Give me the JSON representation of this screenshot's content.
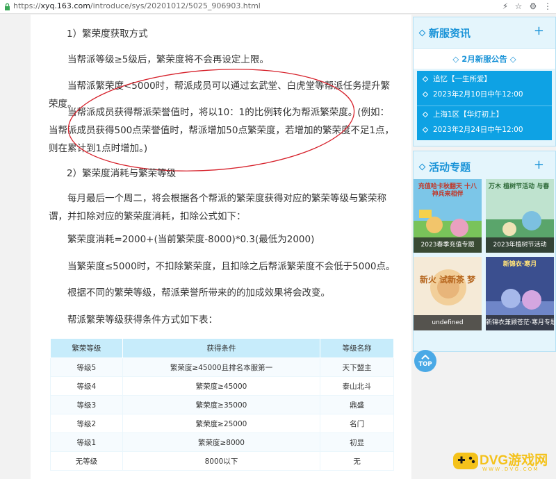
{
  "browser": {
    "url_scheme": "https://",
    "url_host": "xyq.163.com",
    "url_path": "/introduce/sys/20201012/5025_906903.html"
  },
  "article": {
    "heading1": "1）繁荣度获取方式",
    "p1": "当帮派等级≥5级后，繁荣度将不会再设定上限。",
    "p2": "当帮派繁荣度<5000时，帮派成员可以通过玄武堂、白虎堂等帮派任务提升繁荣度。",
    "p3": "当帮派成员获得帮派荣誉值时，将以10：1的比例转化为帮派繁荣度。(例如：当帮派成员获得500点荣誉值时，帮派增加50点繁荣度，若增加的繁荣度不足1点，则在累计到1点时增加。)",
    "heading2": "2）繁荣度消耗与繁荣等级",
    "p4": "每月最后一个周二，将会根据各个帮派的繁荣度获得对应的繁荣等级与繁荣称谓，并扣除对应的繁荣度消耗，扣除公式如下：",
    "p5": "繁荣度消耗=2000+(当前繁荣度-8000)*0.3(最低为2000)",
    "p6": "当繁荣度≤5000时，不扣除繁荣度，且扣除之后帮派繁荣度不会低于5000点。",
    "p7": "根据不同的繁荣等级，帮派荣誉所带来的的加成效果将会改变。",
    "p8": "帮派繁荣等级获得条件方式如下表：",
    "table": {
      "headers": [
        "繁荣等级",
        "获得条件",
        "等级名称"
      ],
      "rows": [
        [
          "等级5",
          "繁荣度≥45000且排名本服第一",
          "天下盟主"
        ],
        [
          "等级4",
          "繁荣度≥45000",
          "泰山北斗"
        ],
        [
          "等级3",
          "繁荣度≥35000",
          "鼎盛"
        ],
        [
          "等级2",
          "繁荣度≥25000",
          "名门"
        ],
        [
          "等级1",
          "繁荣度≥8000",
          "初显"
        ],
        [
          "无等级",
          "8000以下",
          "无"
        ]
      ]
    }
  },
  "sidebar": {
    "news": {
      "title": "新服资讯",
      "plus": "+",
      "notice_title": "2月新服公告",
      "items": [
        {
          "name": "追忆【一生所爱】",
          "date": "2023年2月10日中午12:00"
        },
        {
          "name": "上海1区【华灯初上】",
          "date": "2023年2月24日中午12:00"
        }
      ]
    },
    "activities": {
      "title": "活动专题",
      "plus": "+",
      "tiles": [
        {
          "caption": "2023春季充值专题",
          "art_text": "充值哈卡秋翻天 十八神兵来相伴"
        },
        {
          "caption": "2023年植树节活动",
          "art_text": "万木 植树节活动 与春"
        },
        {
          "caption": "undefined",
          "art_text": "新火 试新茶 梦"
        },
        {
          "caption": "新锦衣兼顾苍茫·寒月专题",
          "art_text": "新锦衣·寒月"
        }
      ]
    },
    "top_button": "TOP"
  },
  "watermark": {
    "text": "DVG游戏网",
    "sub": "W W W . D V G . C O M"
  },
  "colors": {
    "accent": "#1b94d8",
    "news_bg": "#0ea2e4",
    "table_header": "#c7ecfb",
    "annotation": "#d6202a"
  }
}
